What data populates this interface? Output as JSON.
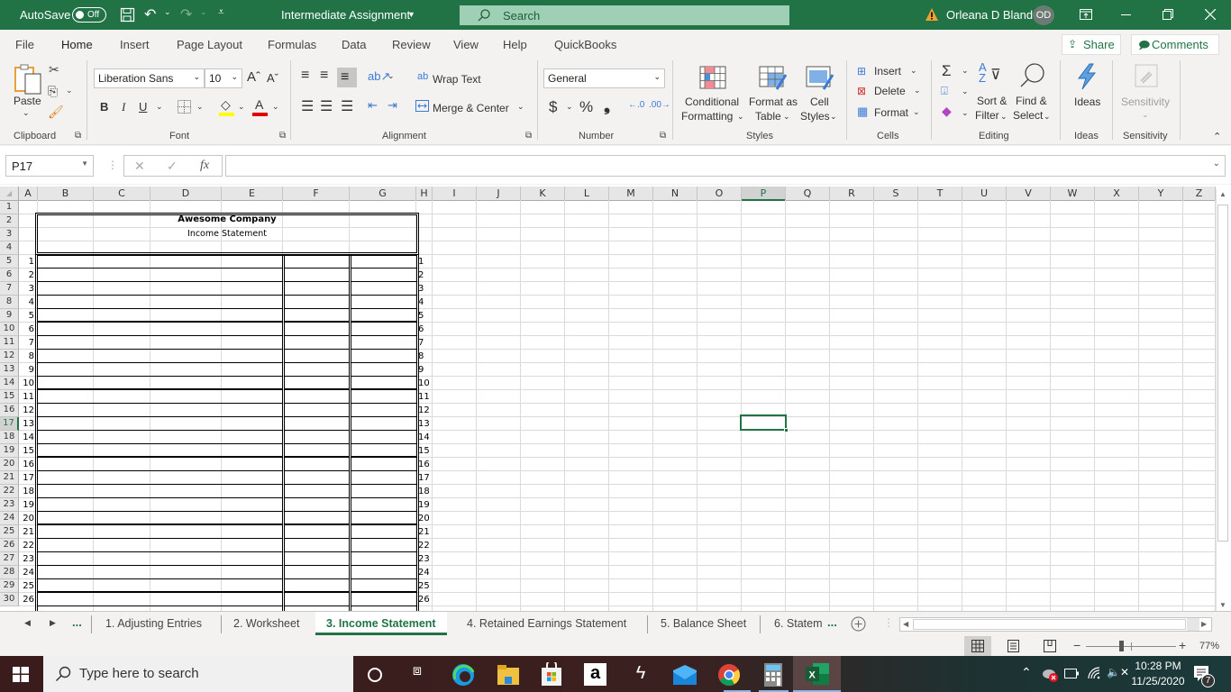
{
  "titlebar": {
    "autosave_label": "AutoSave",
    "autosave_state": "Off",
    "document_title": "Intermediate Assignment",
    "search_placeholder": "Search",
    "user_name": "Orleana D Bland",
    "user_initials": "OD"
  },
  "menu": {
    "tabs": [
      "File",
      "Home",
      "Insert",
      "Page Layout",
      "Formulas",
      "Data",
      "Review",
      "View",
      "Help",
      "QuickBooks"
    ],
    "active": "Home",
    "share_label": "Share",
    "comments_label": "Comments"
  },
  "ribbon": {
    "clipboard": {
      "paste": "Paste",
      "label": "Clipboard"
    },
    "font": {
      "name": "Liberation Sans",
      "size": "10",
      "bold": "B",
      "italic": "I",
      "underline": "U",
      "label": "Font",
      "fill_color": "#ffff00",
      "font_color": "#ff0000"
    },
    "alignment": {
      "wrap_text": "Wrap Text",
      "merge_center": "Merge & Center",
      "label": "Alignment"
    },
    "number": {
      "format": "General",
      "currency": "$",
      "percent": "%",
      "comma": "❟",
      "label": "Number"
    },
    "styles": {
      "conditional_1": "Conditional",
      "conditional_2": "Formatting",
      "format_table_1": "Format as",
      "format_table_2": "Table",
      "cell_styles_1": "Cell",
      "cell_styles_2": "Styles",
      "label": "Styles"
    },
    "cells": {
      "insert": "Insert",
      "delete": "Delete",
      "format": "Format",
      "label": "Cells"
    },
    "editing": {
      "sort_1": "Sort &",
      "sort_2": "Filter",
      "find_1": "Find &",
      "find_2": "Select",
      "label": "Editing"
    },
    "ideas": {
      "button": "Ideas",
      "label": "Ideas"
    },
    "sensitivity": {
      "button": "Sensitivity",
      "label": "Sensitivity"
    }
  },
  "formula_bar": {
    "name_box": "P17",
    "cancel": "✕",
    "enter": "✓",
    "fx": "fx",
    "value": ""
  },
  "grid": {
    "columns": [
      "A",
      "B",
      "C",
      "D",
      "E",
      "F",
      "G",
      "H",
      "I",
      "J",
      "K",
      "L",
      "M",
      "N",
      "O",
      "P",
      "Q",
      "R",
      "S",
      "T",
      "U",
      "V",
      "W",
      "X",
      "Y",
      "Z"
    ],
    "selected_column": "P",
    "selected_row": 17,
    "rows": [
      1,
      2,
      3,
      4,
      5,
      6,
      7,
      8,
      9,
      10,
      11,
      12,
      13,
      14,
      15,
      16,
      17,
      18,
      19,
      20,
      21,
      22,
      23,
      24,
      25,
      26,
      27,
      28,
      29,
      30
    ],
    "company_name": "Awesome Company",
    "statement_title": "Income Statement",
    "line_numbers": [
      "1",
      "2",
      "3",
      "4",
      "5",
      "6",
      "7",
      "8",
      "9",
      "10",
      "11",
      "12",
      "13",
      "14",
      "15",
      "16",
      "17",
      "18",
      "19",
      "20",
      "21",
      "22",
      "23",
      "24",
      "25",
      "26"
    ]
  },
  "sheet_tabs": {
    "items": [
      "1. Adjusting Entries",
      "2. Worksheet",
      "3. Income Statement",
      "4. Retained Earnings Statement",
      "5. Balance Sheet",
      "6. Statem"
    ],
    "active": "3. Income Statement",
    "more": "..."
  },
  "status": {
    "zoom": "77%",
    "zoom_fraction": 0.5
  },
  "taskbar": {
    "search_placeholder": "Type here to search",
    "time": "10:28 PM",
    "date": "11/25/2020",
    "notification_count": "7"
  }
}
